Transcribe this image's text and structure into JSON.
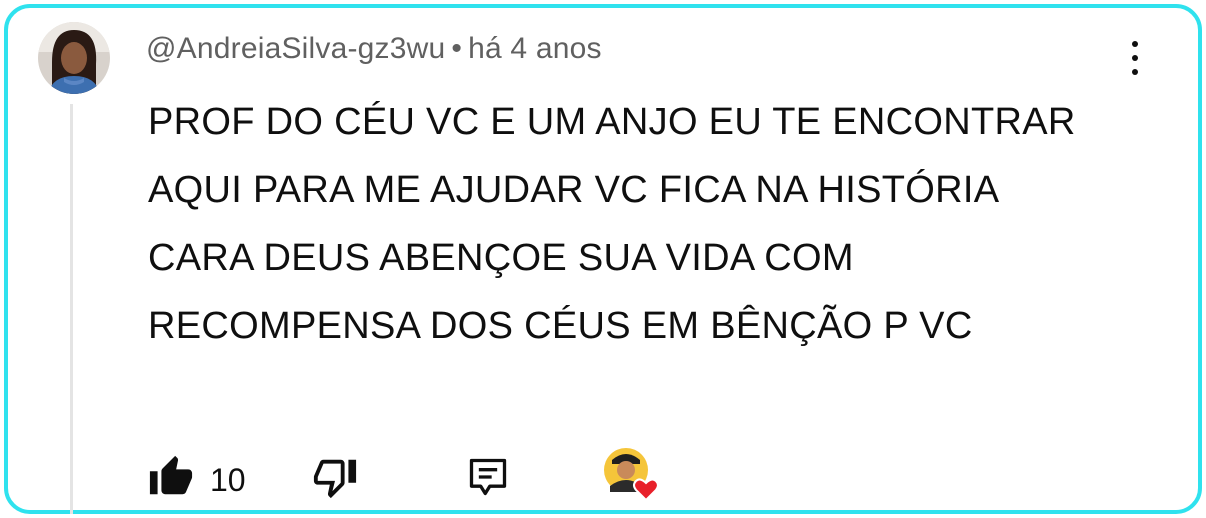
{
  "comment": {
    "author_handle": "@AndreiaSilva-gz3wu",
    "separator": "•",
    "timestamp": "há 4 anos",
    "text": "PROF DO CÉU VC E UM ANJO EU TE ENCONTRAR AQUI PARA ME AJUDAR VC FICA NA HISTÓRIA CARA DEUS ABENÇOE SUA VIDA COM RECOMPENSA DOS CÉUS EM BÊNÇÃO P VC",
    "like_count": "10"
  },
  "icons": {
    "like": "thumbs-up-icon",
    "dislike": "thumbs-down-icon",
    "reply": "reply-comment-icon",
    "menu": "more-vertical-icon",
    "creator_heart": "heart-icon"
  },
  "colors": {
    "frame_border": "#2fe2ee",
    "meta_text": "#606060",
    "body_text": "#0f0f0f",
    "heart": "#e8202a"
  }
}
